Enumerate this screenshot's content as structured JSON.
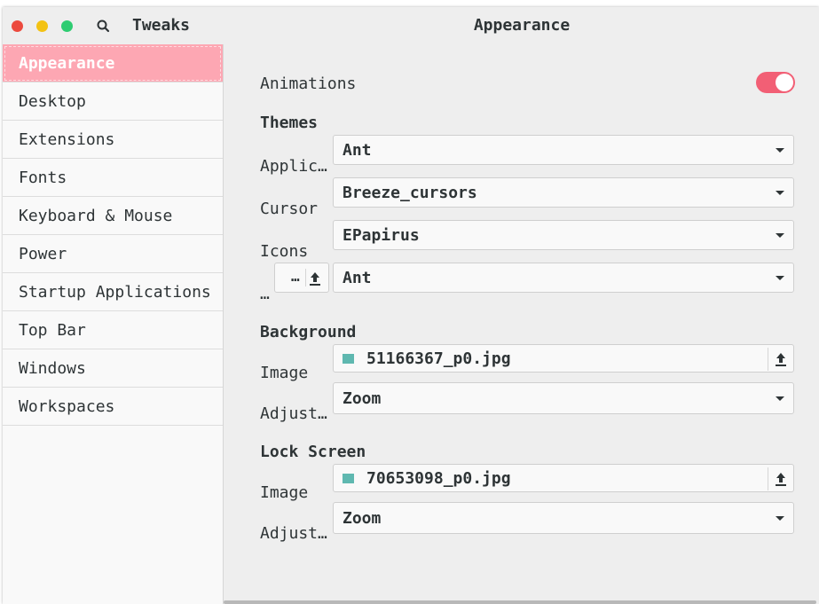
{
  "window": {
    "app_title": "Tweaks",
    "page_title": "Appearance"
  },
  "sidebar": {
    "items": [
      {
        "label": "Appearance",
        "active": true
      },
      {
        "label": "Desktop"
      },
      {
        "label": "Extensions"
      },
      {
        "label": "Fonts"
      },
      {
        "label": "Keyboard & Mouse"
      },
      {
        "label": "Power"
      },
      {
        "label": "Startup Applications"
      },
      {
        "label": "Top Bar"
      },
      {
        "label": "Windows"
      },
      {
        "label": "Workspaces"
      }
    ]
  },
  "appearance": {
    "animations": {
      "label": "Animations",
      "enabled": true
    },
    "themes": {
      "heading": "Themes",
      "applications": {
        "label": "Applic…",
        "value": "Ant"
      },
      "cursor": {
        "label": "Cursor",
        "value": "Breeze_cursors"
      },
      "icons": {
        "label": "Icons",
        "value": "EPapirus"
      },
      "shell": {
        "label": "…",
        "button_label": "…",
        "value": "Ant"
      }
    },
    "background": {
      "heading": "Background",
      "image": {
        "label": "Image",
        "value": "51166367_p0.jpg"
      },
      "adjustment": {
        "label": "Adjust…",
        "value": "Zoom"
      }
    },
    "lock_screen": {
      "heading": "Lock Screen",
      "image": {
        "label": "Image",
        "value": "70653098_p0.jpg"
      },
      "adjustment": {
        "label": "Adjust…",
        "value": "Zoom"
      }
    }
  },
  "colors": {
    "accent": "#f25f75",
    "sidebar_active": "#fda7b3",
    "close": "#ec4a3e",
    "minimize": "#f3c213",
    "maximize": "#2ecc71"
  }
}
